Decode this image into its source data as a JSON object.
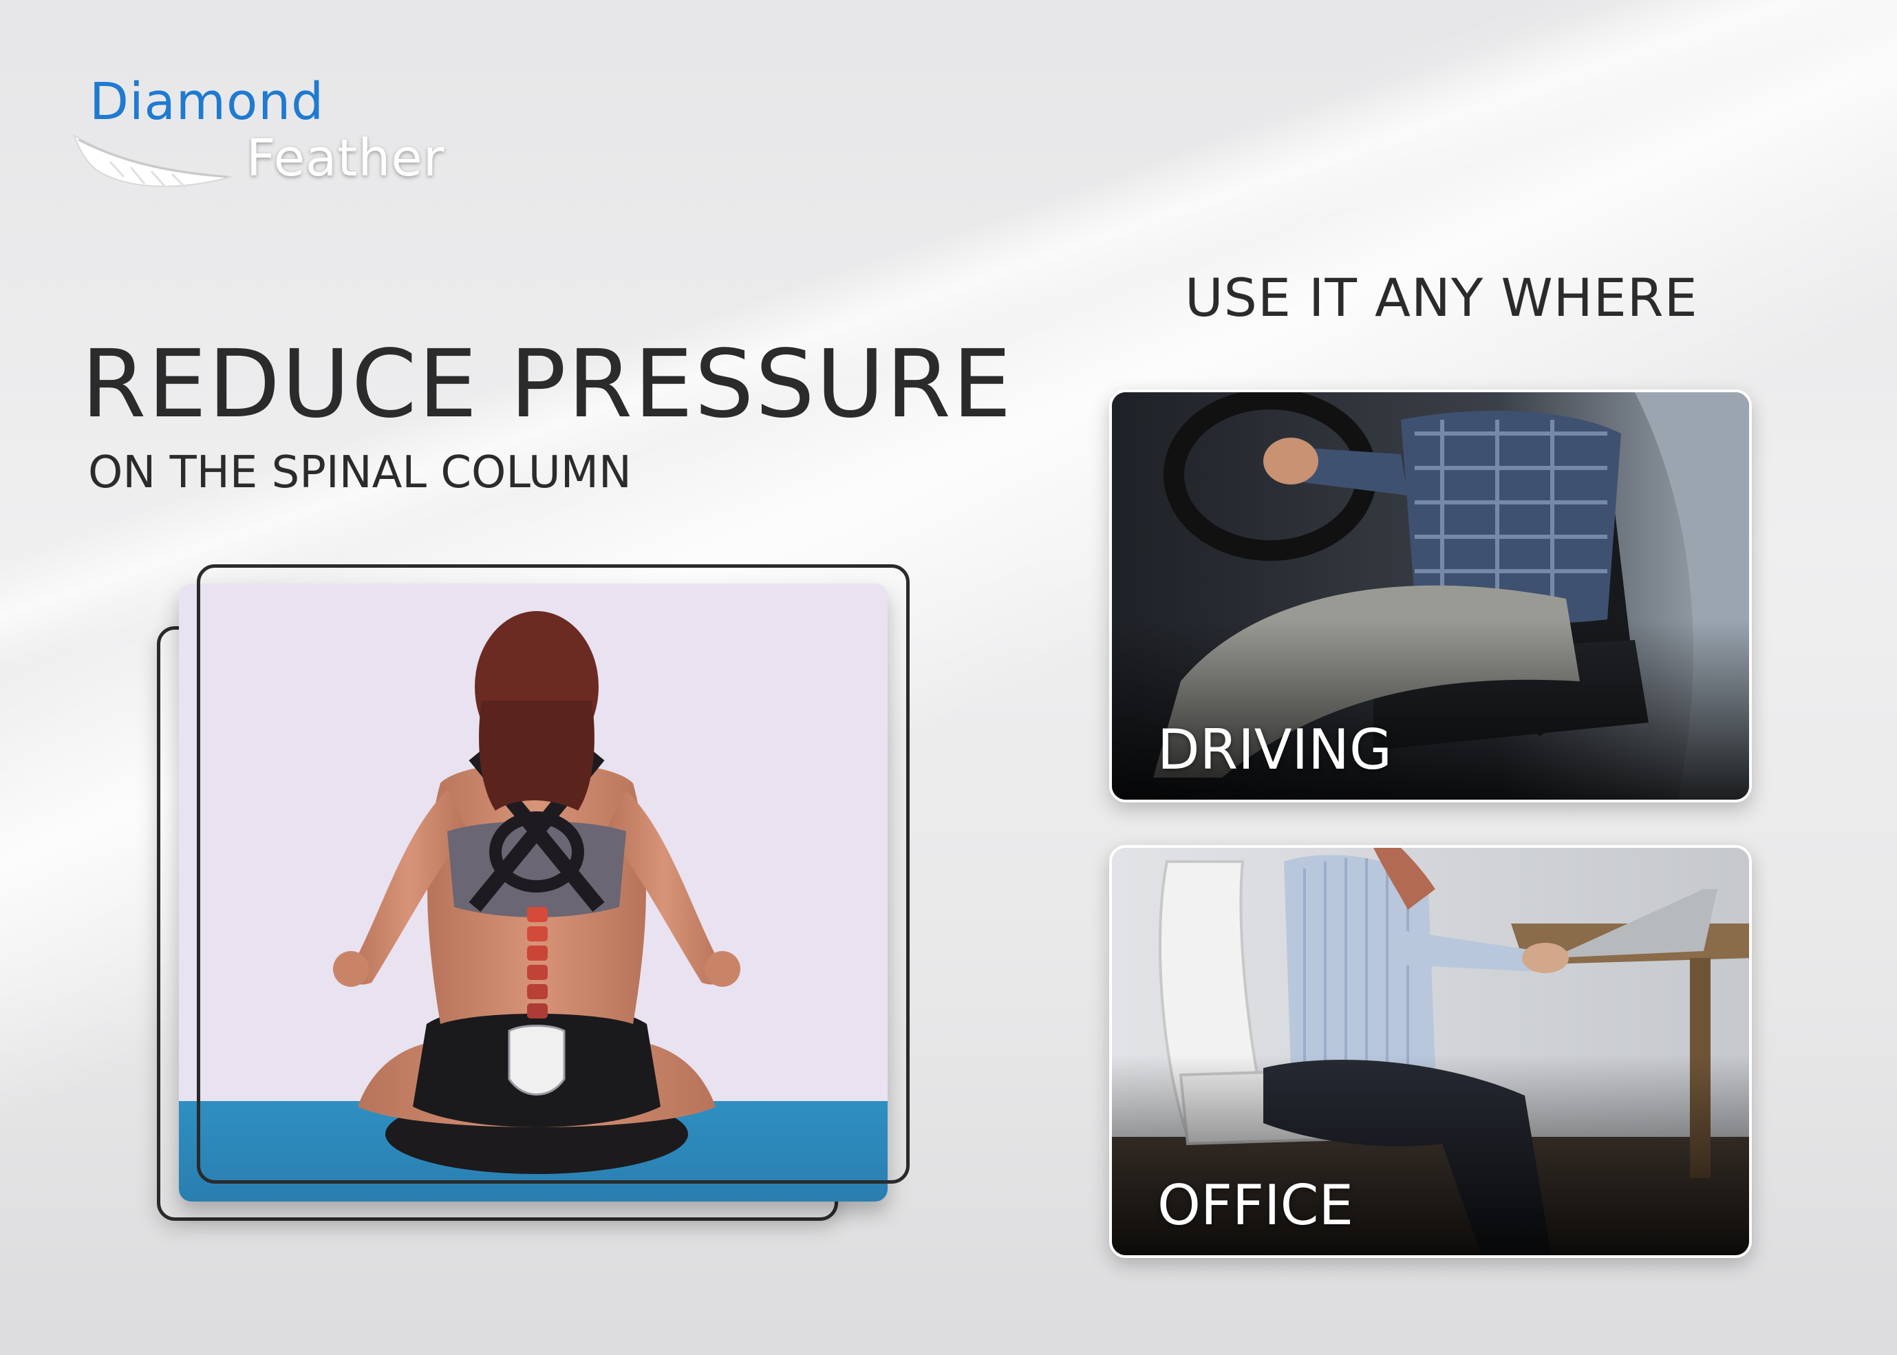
{
  "brand": {
    "line1": "Diamond",
    "line2": "Feather",
    "accent_color": "#1f7ad0"
  },
  "left": {
    "headline": "REDUCE PRESSURE",
    "subheadline": "ON THE SPINAL COLUMN"
  },
  "right": {
    "title": "USE IT ANY WHERE",
    "cards": [
      {
        "label": "DRIVING"
      },
      {
        "label": "OFFICE"
      }
    ]
  },
  "icons": {
    "logo": "feather-icon"
  }
}
